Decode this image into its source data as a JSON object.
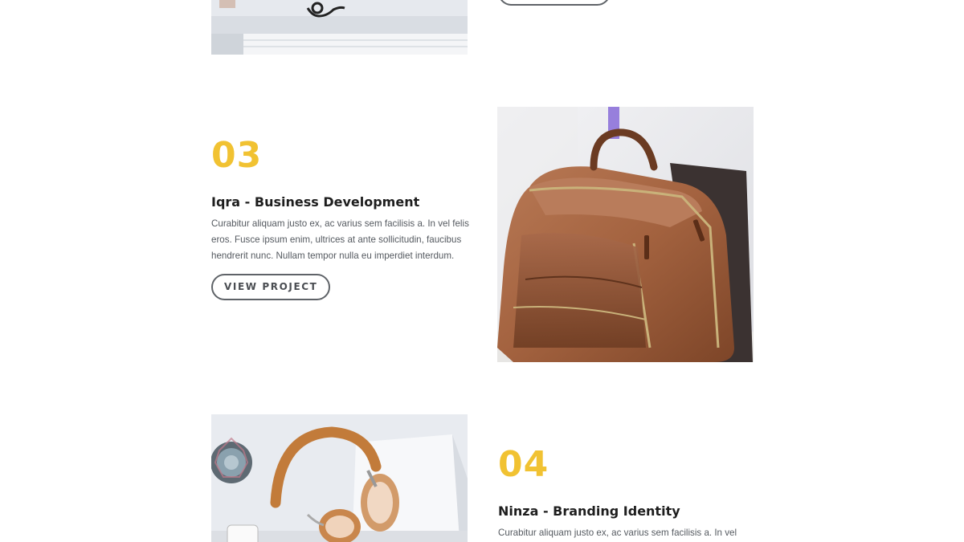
{
  "projects": [
    {
      "number": "03",
      "title": "Iqra - Business Development",
      "description": "Curabitur aliquam justo ex, ac varius sem facilisis a. In vel felis eros. Fusce ipsum enim, ultrices at ante sollicitudin, faucibus hendrerit nunc. Nullam tempor nulla eu imperdiet interdum.",
      "button_label": "VIEW PROJECT",
      "image": "leather-backpack-photo"
    },
    {
      "number": "04",
      "title": "Ninza - Branding Identity",
      "description": "Curabitur aliquam justo ex, ac varius sem facilisis a. In vel",
      "image": "headphones-desk-photo"
    }
  ],
  "previous_image": "glasses-desk-photo",
  "colors": {
    "accent": "#f1c232",
    "title": "#1e1e1e",
    "body_text": "#555a60",
    "button_border": "#5f6368"
  }
}
